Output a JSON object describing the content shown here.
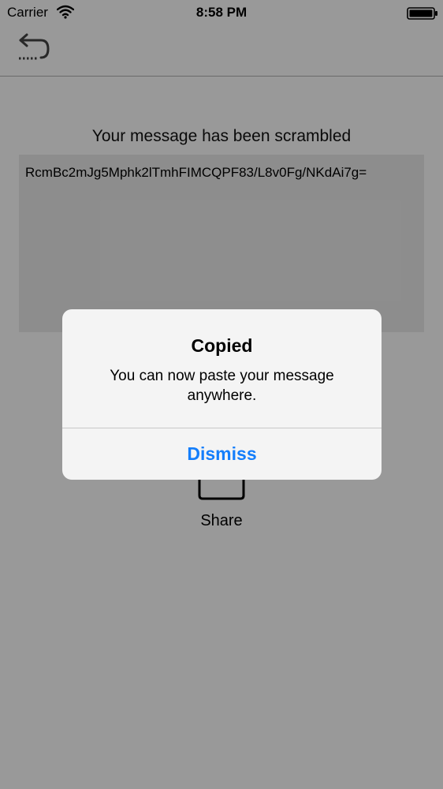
{
  "status_bar": {
    "carrier": "Carrier",
    "time": "8:58 PM",
    "icons": [
      "wifi-icon",
      "battery-icon"
    ]
  },
  "nav": {
    "back_icon": "undo-arrow-icon"
  },
  "content": {
    "headline": "Your message has been scrambled",
    "scrambled_text": "RcmBc2mJg5Mphk2lTmhFIMCQPF83/L8v0Fg/NKdAi7g=",
    "share_label": "Share",
    "share_icon": "share-icon"
  },
  "alert": {
    "title": "Copied",
    "message": "You can now paste your message anywhere.",
    "dismiss_label": "Dismiss"
  },
  "colors": {
    "accent": "#147efb",
    "overlay": "rgba(0,0,0,0.40)",
    "message_box_bg": "#ececec"
  }
}
